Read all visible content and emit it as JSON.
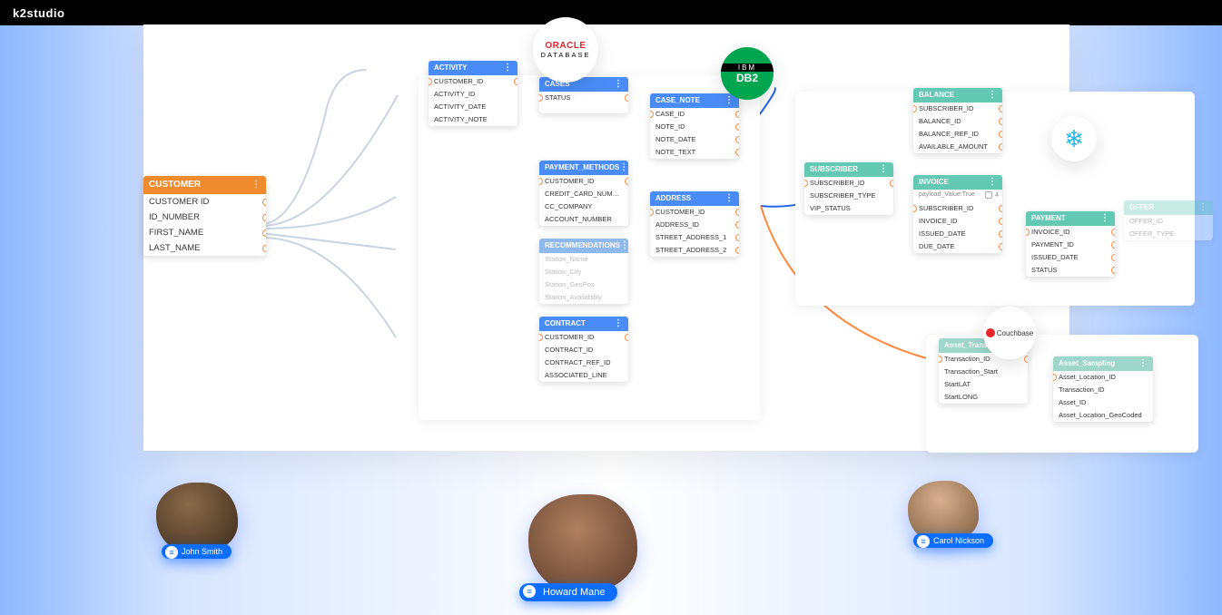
{
  "app_title_prefix": "k2",
  "app_title_suffix": "studio",
  "brands": {
    "oracle_top": "ORACLE",
    "oracle_bottom": "DATABASE",
    "ibm": "IBM",
    "db2": "DB2",
    "couchbase": "Couchbase"
  },
  "people": {
    "a": "John Smith",
    "b": "Howard Mane",
    "c": "Carol Nickson"
  },
  "customer": {
    "title": "CUSTOMER",
    "fields": [
      "CUSTOMER ID",
      "ID_NUMBER",
      "FIRST_NAME",
      "LAST_NAME"
    ]
  },
  "tables": {
    "activity": {
      "title": "ACTIVITY",
      "fields": [
        "CUSTOMER_ID",
        "ACTIVITY_ID",
        "ACTIVITY_DATE",
        "ACTIVITY_NOTE"
      ]
    },
    "cases": {
      "title": "CASES",
      "fields": [
        "STATUS"
      ]
    },
    "case_note": {
      "title": "CASE_NOTE",
      "fields": [
        "CASE_ID",
        "NOTE_ID",
        "NOTE_DATE",
        "NOTE_TEXT"
      ]
    },
    "payment_methods": {
      "title": "PAYMENT_METHODS",
      "fields": [
        "CUSTOMER_ID",
        "CREDIT_CARD_NUMBER",
        "CC_COMPANY",
        "ACCOUNT_NUMBER"
      ]
    },
    "address": {
      "title": "ADDRESS",
      "fields": [
        "CUSTOMER_ID",
        "ADDRESS_ID",
        "STREET_ADDRESS_1",
        "STREET_ADDRESS_2"
      ]
    },
    "recommendations": {
      "title": "RECOMMENDATIONS",
      "fields": [
        "Station_Name",
        "Station_City",
        "Station_GeoPos",
        "Station_Availability"
      ]
    },
    "contract": {
      "title": "CONTRACT",
      "fields": [
        "CUSTOMER_ID",
        "CONTRACT_ID",
        "CONTRACT_REF_ID",
        "ASSOCIATED_LINE"
      ]
    },
    "subscriber": {
      "title": "SUBSCRIBER",
      "fields": [
        "SUBSCRIBER_ID",
        "SUBSCRIBER_TYPE",
        "VIP_STATUS"
      ]
    },
    "balance": {
      "title": "BALANCE",
      "fields": [
        "SUBSCRIBER_ID",
        "BALANCE_ID",
        "BALANCE_REF_ID",
        "AVAILABLE_AMOUNT"
      ]
    },
    "invoice": {
      "title": "INVOICE",
      "fields": [
        "SUBSCRIBER_ID",
        "INVOICE_ID",
        "ISSUED_DATE",
        "DUE_DATE"
      ],
      "annot": "payload_Value:True",
      "annot_n": "4"
    },
    "payment": {
      "title": "PAYMENT",
      "fields": [
        "INVOICE_ID",
        "PAYMENT_ID",
        "ISSUED_DATE",
        "STATUS"
      ]
    },
    "offer": {
      "title": "OFFER",
      "fields": [
        "OFFER_ID",
        "OFFER_TYPE"
      ]
    },
    "asset_tx": {
      "title": "Asset_Transaction",
      "fields": [
        "Transaction_ID",
        "Transaction_Start",
        "StartLAT",
        "StartLONG"
      ]
    },
    "asset_sampling": {
      "title": "Asset_Sampling",
      "fields": [
        "Asset_Location_ID",
        "Transaction_ID",
        "Asset_ID",
        "Asset_Location_GeoCoded"
      ]
    }
  }
}
